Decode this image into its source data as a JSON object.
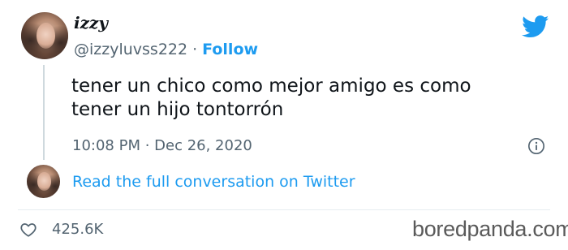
{
  "tweet": {
    "display_name": "izzy",
    "handle": "@izzyluvss222",
    "separator": "·",
    "follow_label": "Follow",
    "text": "tener un chico como mejor amigo es como tener un hijo tontorrón",
    "timestamp": "10:08 PM · Dec 26, 2020",
    "read_conversation_label": "Read the full conversation on Twitter",
    "likes": "425.6K",
    "brand_color": "#1d9bf0"
  },
  "icons": {
    "logo": "twitter-bird-icon",
    "info": "info-circle-icon",
    "like": "heart-outline-icon"
  },
  "watermark": {
    "text": "boredpanda.com"
  }
}
